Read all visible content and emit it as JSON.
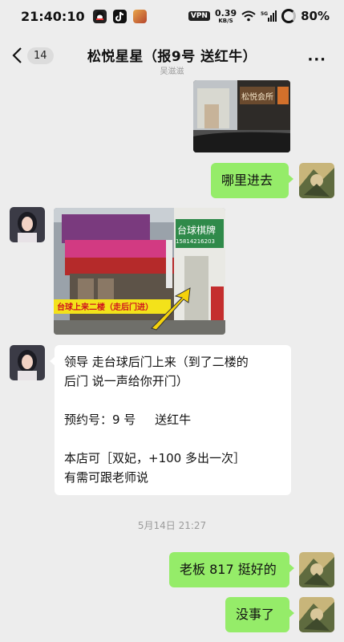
{
  "status_bar": {
    "time": "21:40:10",
    "vpn": "VPN",
    "speed_value": "0.39",
    "speed_unit": "KB/S",
    "battery": "80%"
  },
  "header": {
    "back_count": "14",
    "title": "松悦星星（报9号 送红牛）",
    "subtitle": "吴滋滋",
    "more": "···"
  },
  "messages": {
    "m1_text": "哪里进去",
    "image2_caption": "台球上来二楼（走后门进）",
    "image2_shop_sign": "台球棋牌",
    "image2_phone": "15814216203",
    "image1_sign": "松悦会所",
    "m3_lines": [
      "领导 走台球后门上来（到了二楼的",
      "后门 说一声给你开门）",
      "预约号：9 号     送红牛",
      "本店可［双妃，+100 多出一次］",
      "有需可跟老师说"
    ],
    "timestamp": "5月14日 21:27",
    "m4_text": "老板 817 挺好的",
    "m5_text": "没事了"
  },
  "colors": {
    "background": "#ededed",
    "bubble_sent": "#95ec69",
    "bubble_received": "#ffffff"
  }
}
